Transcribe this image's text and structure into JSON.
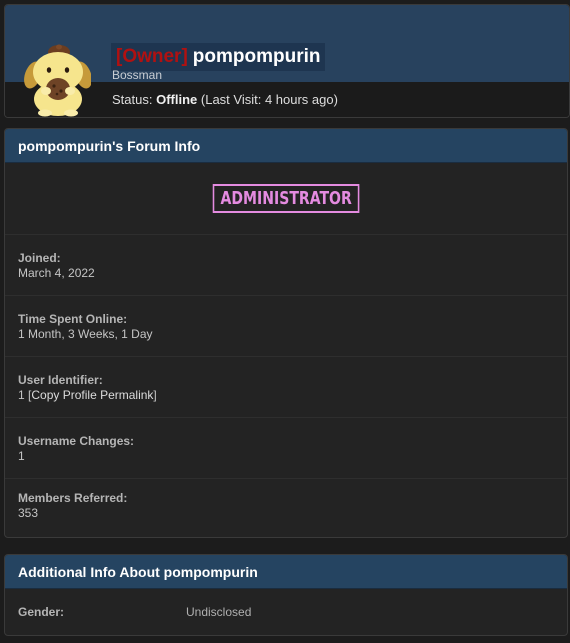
{
  "profile": {
    "owner_tag": "[Owner]",
    "username": "pompompurin",
    "title": "Bossman",
    "status_label": "Status:",
    "status_value": "Offline",
    "last_visit": "(Last Visit: 4 hours ago)",
    "avatar_icon": "pompompurin-avatar-icon",
    "owner_color": "#b01111"
  },
  "forum_info": {
    "header": "pompompurin's Forum Info",
    "badge": "ADMINISTRATOR",
    "badge_color": "#e48be0",
    "rows": [
      {
        "label": "Joined:",
        "value": "March 4, 2022"
      },
      {
        "label": "Time Spent Online:",
        "value": "1 Month, 3 Weeks, 1 Day"
      },
      {
        "label": "User Identifier:",
        "value": "1",
        "link": "Copy Profile Permalink"
      },
      {
        "label": "Username Changes:",
        "value": "1"
      },
      {
        "label": "Members Referred:",
        "value": "353"
      }
    ]
  },
  "additional_info": {
    "header": "Additional Info About pompompurin",
    "gender_label": "Gender:",
    "gender_value": "Undisclosed"
  },
  "colors": {
    "header_blue": "#254461",
    "banner_blue": "#28425e",
    "background": "#1c1c1c"
  }
}
